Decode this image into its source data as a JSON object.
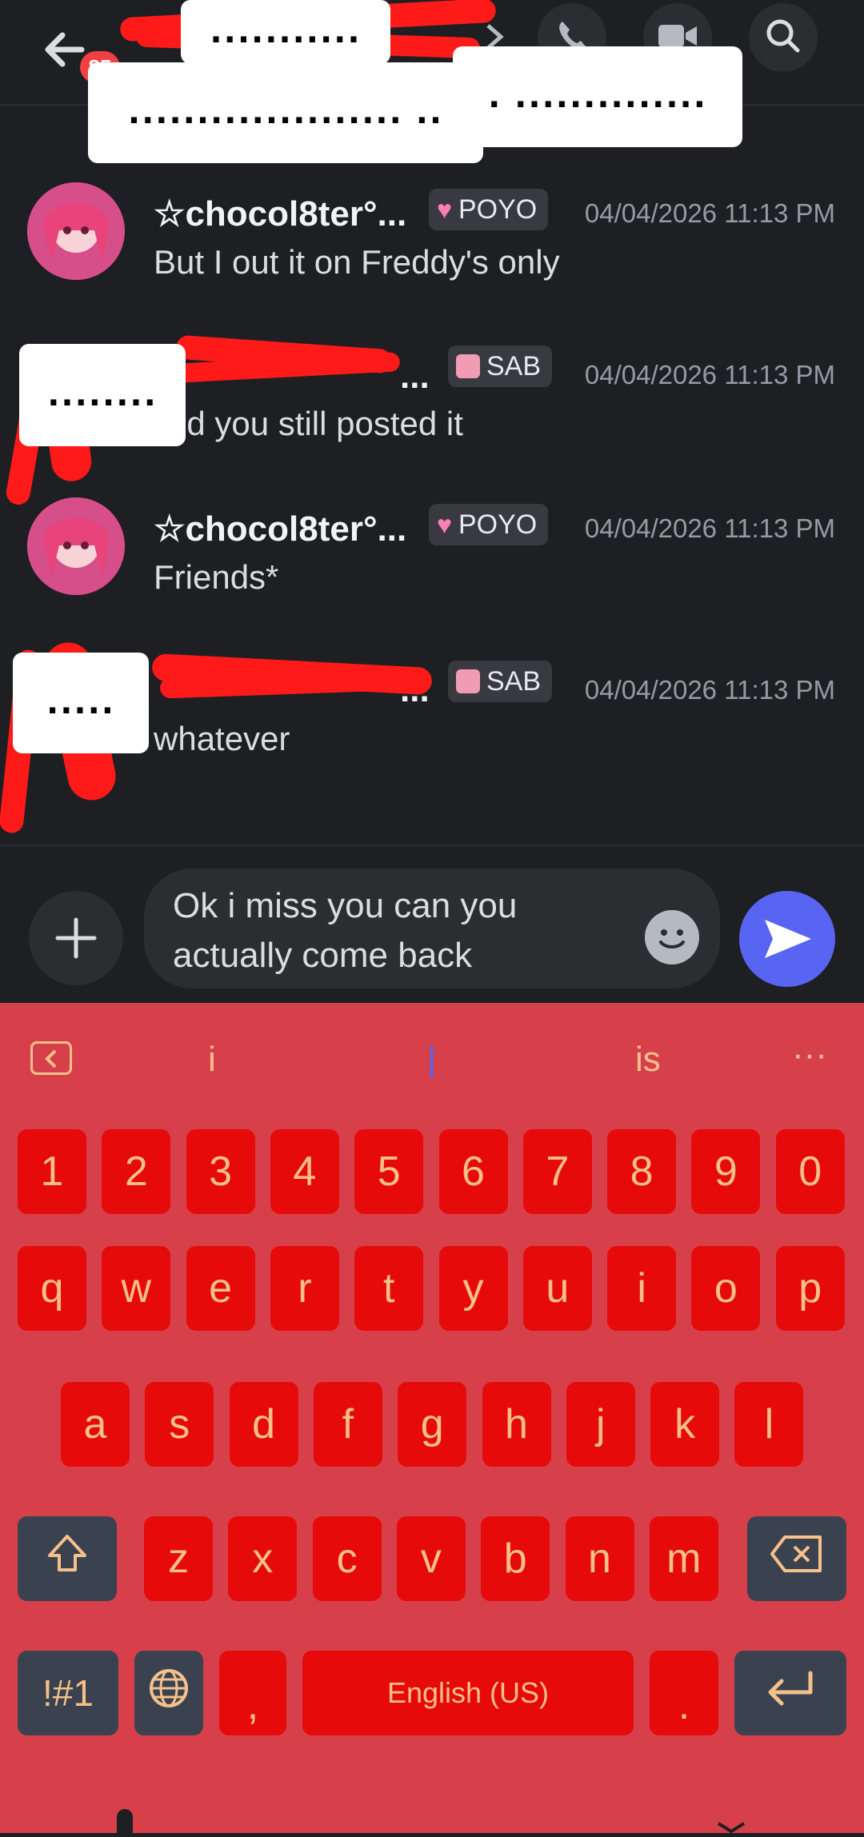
{
  "header": {
    "redacted_1": "...........",
    "redacted_2": ".................... ..",
    "redacted_3": ". ..............",
    "badge": "85"
  },
  "messages": [
    {
      "name": "☆chocol8ter°...",
      "tag": "POYO",
      "time": "04/04/2026 11:13 PM",
      "text": "But I out it on Freddy's only"
    },
    {
      "name": "",
      "redacted": "........",
      "name_tail": "...",
      "tag": "SAB",
      "time": "04/04/2026 11:13 PM",
      "text": "nd you still posted it"
    },
    {
      "name": "☆chocol8ter°...",
      "tag": "POYO",
      "time": "04/04/2026 11:13 PM",
      "text": "Friends*"
    },
    {
      "name": "",
      "redacted": ".....",
      "name_tail": "...",
      "tag": "SAB",
      "time": "04/04/2026 11:13 PM",
      "text": "whatever"
    }
  ],
  "composer": {
    "text_line1": "Ok i miss you can you",
    "text_line2": "actually come back"
  },
  "keyboard": {
    "suggestions": [
      "i",
      "|",
      "is"
    ],
    "more": "···",
    "row_numbers": [
      "1",
      "2",
      "3",
      "4",
      "5",
      "6",
      "7",
      "8",
      "9",
      "0"
    ],
    "row_1": [
      "q",
      "w",
      "e",
      "r",
      "t",
      "y",
      "u",
      "i",
      "o",
      "p"
    ],
    "row_2": [
      "a",
      "s",
      "d",
      "f",
      "g",
      "h",
      "j",
      "k",
      "l"
    ],
    "row_3": [
      "z",
      "x",
      "c",
      "v",
      "b",
      "n",
      "m"
    ],
    "symbols_label": "!#1",
    "comma": ",",
    "space_label": "English (US)",
    "period": "."
  },
  "colors": {
    "background": "#1e1f22",
    "accent": "#5865f2",
    "keyboard_bg": "#d7404a",
    "key_bg": "#e60a0a",
    "key_text": "#f6c08a",
    "redaction": "#ff1a1a"
  }
}
